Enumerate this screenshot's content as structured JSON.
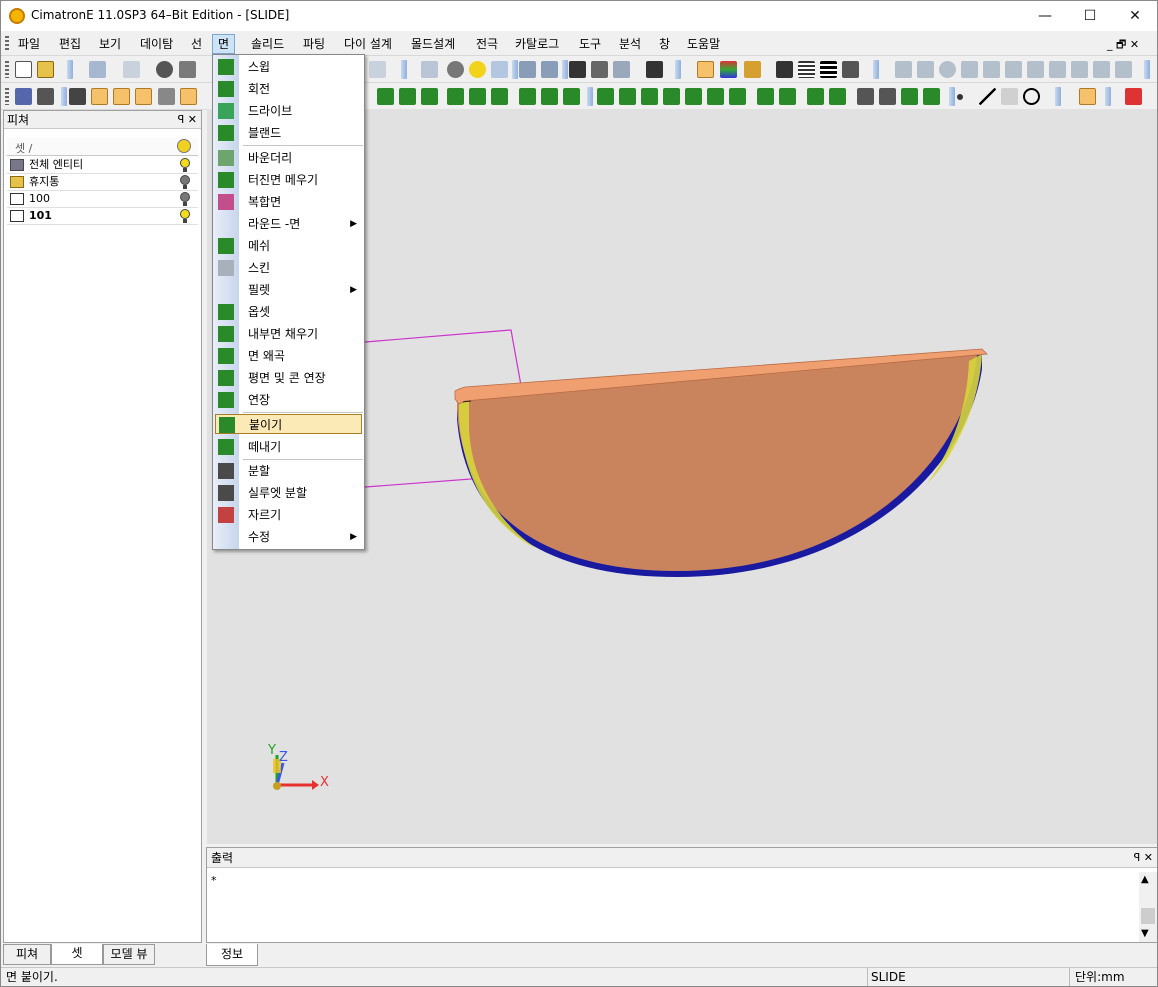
{
  "window": {
    "title": "CimatronE 11.0SP3 64–Bit Edition - [SLIDE]",
    "minimize": "—",
    "maximize": "☐",
    "close": "✕"
  },
  "menubar": {
    "items": [
      "파일",
      "편집",
      "보기",
      "데이탐",
      "선",
      "면",
      "솔리드",
      "파팅",
      "다이 설계",
      "몰드설계",
      "전극",
      "카탈로그",
      "도구",
      "분석",
      "창",
      "도움말"
    ],
    "open_item": "면",
    "mdi_controls": "_ 🗗 ✕"
  },
  "colors": {
    "accent_menu_highlight": "#fbe9b6",
    "model_fill": "#c9845e",
    "model_top": "#f0a070",
    "outline": "#cc33cc",
    "axis_x": "#e83030",
    "axis_y": "#1fa51f",
    "axis_z": "#3b57e8"
  },
  "left_panel": {
    "title": "피쳐",
    "pin": "ꟼ ✕",
    "column_header": "셋 /",
    "rows": [
      {
        "label": "전체 엔티티",
        "icon": "entity-set-icon",
        "lamp": "on"
      },
      {
        "label": "휴지통",
        "icon": "trash-icon",
        "lamp": "off"
      },
      {
        "label": "100",
        "icon": "set-icon",
        "lamp": "off"
      },
      {
        "label": "101",
        "icon": "set-icon",
        "lamp": "on",
        "bold": true
      }
    ],
    "tabs": [
      "피쳐",
      "셋",
      "모델 뷰"
    ],
    "active_tab": "셋"
  },
  "dropdown_menu": {
    "groups": [
      [
        {
          "label": "스윕",
          "icon": "sweep-icon"
        },
        {
          "label": "회전",
          "icon": "revolve-icon"
        },
        {
          "label": "드라이브",
          "icon": "drive-icon"
        },
        {
          "label": "블랜드",
          "icon": "blend-icon"
        }
      ],
      [
        {
          "label": "바운더리",
          "icon": "boundary-icon"
        },
        {
          "label": "터진면 메우기",
          "icon": "fill-hole-icon"
        },
        {
          "label": "복합면",
          "icon": "composite-icon"
        },
        {
          "label": "라운드 -면",
          "icon": "",
          "submenu": true
        },
        {
          "label": "메쉬",
          "icon": "mesh-icon"
        },
        {
          "label": "스킨",
          "icon": "skin-icon"
        },
        {
          "label": "필렛",
          "icon": "",
          "submenu": true
        },
        {
          "label": "옵셋",
          "icon": "offset-icon"
        },
        {
          "label": "내부면 채우기",
          "icon": "inner-fill-icon"
        },
        {
          "label": "면 왜곡",
          "icon": "warp-icon"
        },
        {
          "label": "평면 및 콘 연장",
          "icon": "extend-cone-icon"
        },
        {
          "label": "연장",
          "icon": "extend-icon"
        }
      ],
      [
        {
          "label": "붙이기",
          "icon": "attach-icon",
          "highlighted": true
        },
        {
          "label": "떼내기",
          "icon": "detach-icon"
        }
      ],
      [
        {
          "label": "분할",
          "icon": "split-icon"
        },
        {
          "label": "실루엣 분할",
          "icon": "silhouette-split-icon"
        },
        {
          "label": "자르기",
          "icon": "trim-icon"
        },
        {
          "label": "수정",
          "icon": "",
          "submenu": true
        }
      ]
    ]
  },
  "viewport": {
    "axis_x_label": "X",
    "axis_y_label": "Y",
    "axis_z_label": "Z"
  },
  "output_panel": {
    "title": "출력",
    "content": "*",
    "tab": "정보",
    "pin": "ꟼ ✕"
  },
  "status_bar": {
    "message": "면 붙이기.",
    "file": "SLIDE",
    "units": "단위:mm"
  }
}
